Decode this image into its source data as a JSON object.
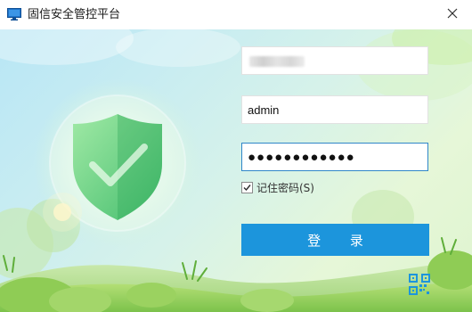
{
  "window": {
    "title": "固信安全管控平台"
  },
  "login": {
    "server_value": "",
    "username_value": "admin",
    "password_value": "●●●●●●●●●●●●",
    "remember_label": "记住密码(S)",
    "remember_checked": true,
    "login_label": "登 录"
  },
  "icons": {
    "app": "monitor-icon",
    "close": "close-icon",
    "shield": "shield-check-icon",
    "qr": "qr-code-icon",
    "check": "checkmark-icon"
  },
  "colors": {
    "accent": "#1c95dc",
    "focus_border": "#2f86c8",
    "shield": "#4fc97a"
  }
}
